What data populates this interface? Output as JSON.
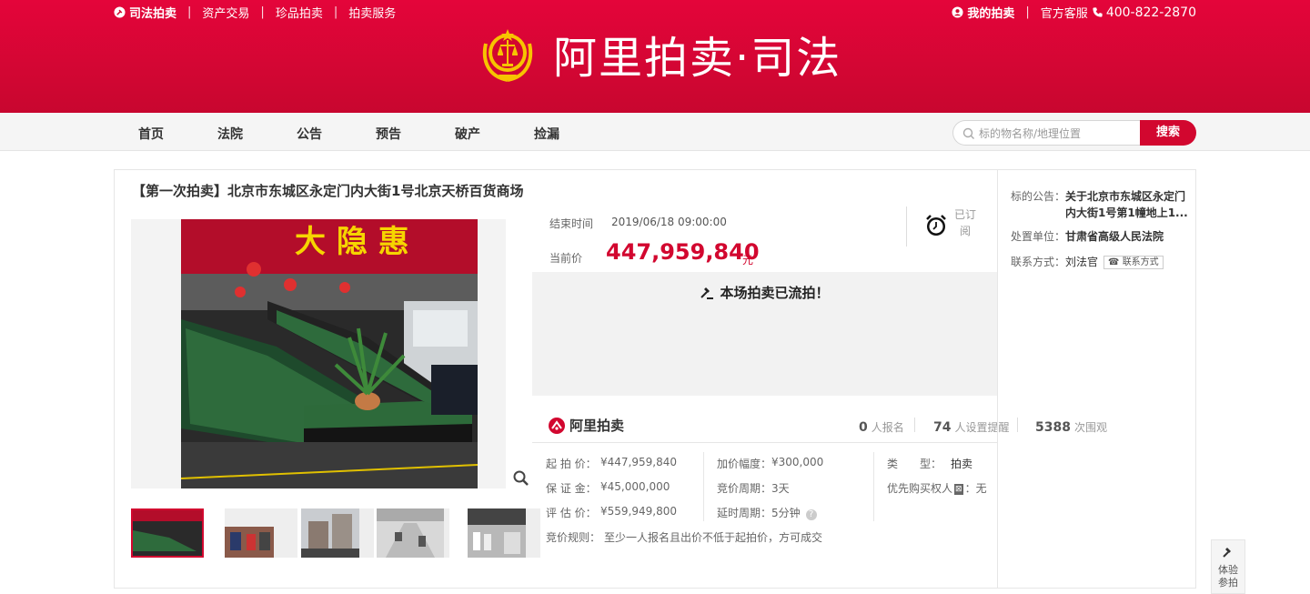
{
  "topbar": {
    "left_items": [
      "司法拍卖",
      "资产交易",
      "珍品拍卖",
      "拍卖服务"
    ],
    "my_auction": "我的拍卖",
    "service_label": "官方客服",
    "phone": "400-822-2870"
  },
  "logo": {
    "text": "阿里拍卖·司法"
  },
  "nav": {
    "items": [
      "首页",
      "法院",
      "公告",
      "预告",
      "破产",
      "捡漏"
    ],
    "search_placeholder": "标的物名称/地理位置",
    "search_button": "搜索"
  },
  "item": {
    "title": "【第一次拍卖】北京市东城区永定门内大街1号北京天桥百货商场",
    "end_time_label": "结束时间",
    "end_time": "2019/06/18 09:00:00",
    "current_price_label": "当前价",
    "current_price": "447,959,840",
    "price_unit": "元",
    "subscribe_text": "已订阅",
    "status_message": "本场拍卖已流拍！",
    "brand": "阿里拍卖",
    "stats": [
      {
        "num": "0",
        "label": "人报名"
      },
      {
        "num": "74",
        "label": "人设置提醒"
      },
      {
        "num": "5388",
        "label": "次围观"
      }
    ],
    "params": {
      "start_price_label": "起 拍 价：",
      "start_price": "¥447,959,840",
      "deposit_label": "保 证 金：",
      "deposit": "¥45,000,000",
      "estimate_label": "评 估 价：",
      "estimate": "¥559,949,800",
      "increment_label": "加价幅度：",
      "increment": "¥300,000",
      "period_label": "竞价周期：",
      "period": "3天",
      "delay_label": "延时周期：",
      "delay": "5分钟",
      "type_label": "类　　型：",
      "type": "拍卖",
      "priority_label": "优先购买权人",
      "priority_icon": "⊠",
      "priority": "：无",
      "rule_label": "竞价规则：",
      "rule": "至少一人报名且出价不低于起拍价，方可成交"
    }
  },
  "right_panel": {
    "notice_label": "标的公告：",
    "notice_line1": "关于北京市东城区永定门",
    "notice_line2": "内大街1号第1幢地上1...",
    "unit_label": "处置单位：",
    "unit": "甘肃省高级人民法院",
    "contact_label": "联系方式：",
    "contact": "刘法官",
    "contact_button": "联系方式"
  },
  "float_widget": {
    "line1": "体验",
    "line2": "参拍"
  },
  "colors": {
    "brand_red": "#d2072f",
    "header_red": "#e4053a"
  }
}
